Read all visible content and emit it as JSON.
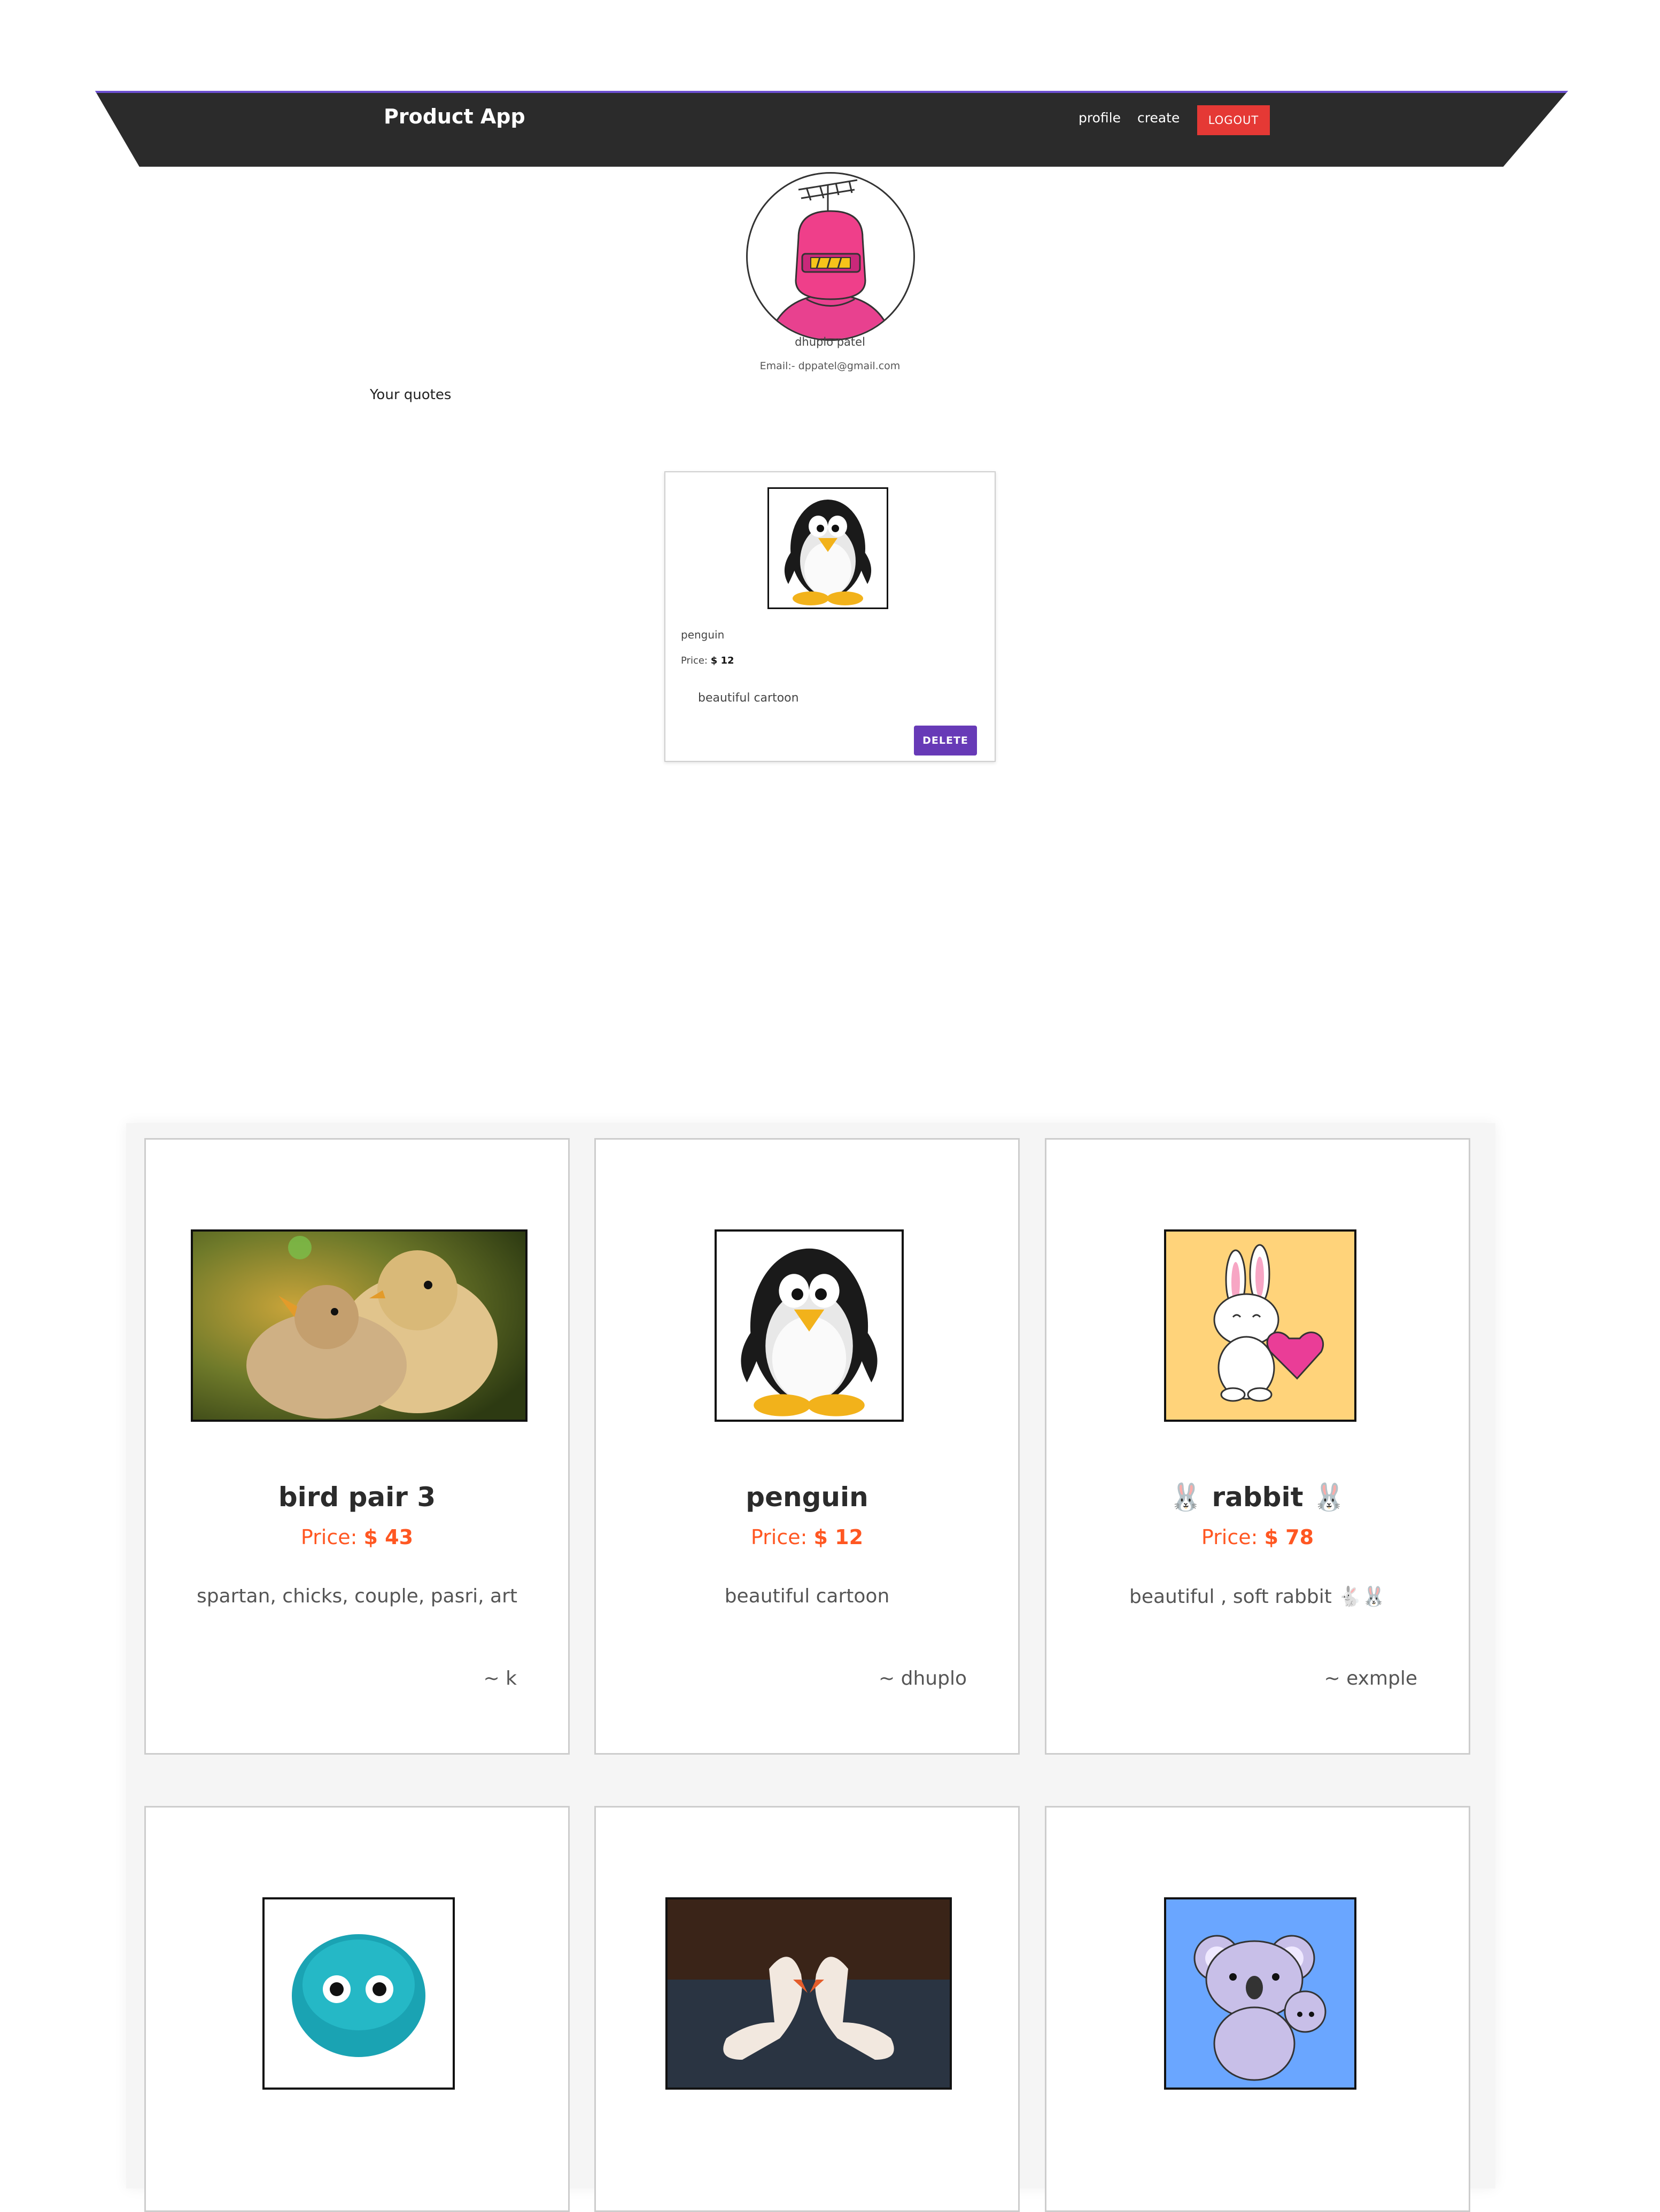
{
  "header": {
    "brand": "Product App",
    "nav": {
      "profile": "profile",
      "create": "create",
      "logout": "LOGOUT"
    }
  },
  "colors": {
    "header_bg": "#2b2b2b",
    "logout_bg": "#e53935",
    "delete_bg": "#673ab7",
    "price_color": "#ff5722"
  },
  "profile": {
    "name": "dhuplo patel",
    "email": "Email:- dppatel@gmail.com",
    "avatar_icon": "pink-robot-icon",
    "section_title": "Your quotes"
  },
  "my_quotes": [
    {
      "title": "penguin",
      "price_label": "Price:",
      "price_value": "$ 12",
      "description": "beautiful cartoon",
      "delete_label": "DELETE",
      "image_icon": "penguin-icon"
    }
  ],
  "quotes": [
    {
      "title": "bird pair 3",
      "price_label": "Price:",
      "price_value": "$ 43",
      "description": "spartan, chicks, couple, pasri, art",
      "author": "~ k",
      "image_icon": "chicks-photo"
    },
    {
      "title": "penguin",
      "price_label": "Price:",
      "price_value": "$ 12",
      "description": "beautiful cartoon",
      "author": "~ dhuplo",
      "image_icon": "penguin-icon"
    },
    {
      "title": "🐰 rabbit 🐰",
      "price_label": "Price:",
      "price_value": "$ 78",
      "description": "beautiful , soft rabbit 🐇🐰",
      "author": "~ exmple",
      "image_icon": "bunny-heart-icon"
    },
    {
      "title": "",
      "price_label": "",
      "price_value": "",
      "description": "",
      "author": "",
      "image_icon": "fluffy-blue-ball-icon"
    },
    {
      "title": "",
      "price_label": "",
      "price_value": "",
      "description": "",
      "author": "",
      "image_icon": "swans-photo"
    },
    {
      "title": "",
      "price_label": "",
      "price_value": "",
      "description": "",
      "author": "",
      "image_icon": "koala-icon"
    }
  ]
}
